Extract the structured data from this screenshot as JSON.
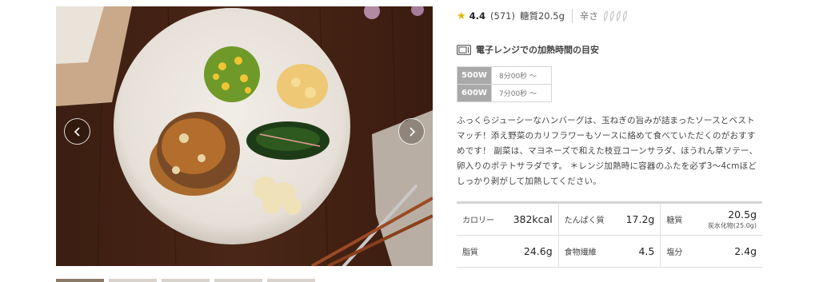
{
  "product": {
    "rating": "4.4",
    "review_count": "(571)",
    "carbs_badge": "糖質20.5g",
    "spicy_label": "辛さ",
    "spicy_level": 0
  },
  "microwave": {
    "title": "電子レンジでの加熱時間の目安",
    "rows": [
      {
        "watt": "500W",
        "time": "8分00秒 〜"
      },
      {
        "watt": "600W",
        "time": "7分00秒 〜"
      }
    ]
  },
  "description": "ふっくらジューシーなハンバーグは、玉ねぎの旨みが詰まったソースとベストマッチ！添え野菜のカリフラワーもソースに絡めて食べていただくのがおすすめです！ 副菜は、マヨネーズで和えた枝豆コーンサラダ、ほうれん草ソテー、卵入りのポテトサラダです。 ＊レンジ加熱時に容器のふたを必ず3〜4cmほどしっかり剥がして加熱してください。",
  "nutrition": {
    "row1": [
      {
        "label": "カロリー",
        "value": "382kcal"
      },
      {
        "label": "たんぱく質",
        "value": "17.2g"
      },
      {
        "label": "糖質",
        "value": "20.5g",
        "sub": "炭水化物(25.0g)"
      }
    ],
    "row2": [
      {
        "label": "脂質",
        "value": "24.6g"
      },
      {
        "label": "食物繊維",
        "value": "4.5"
      },
      {
        "label": "塩分",
        "value": "2.4g"
      }
    ]
  },
  "gallery": {
    "prev_icon": "chevron-left-icon",
    "next_icon": "chevron-right-icon",
    "active_index": 0,
    "thumb_count": 5
  },
  "colors": {
    "star": "#e8b400",
    "watt_bg": "#a9a9a9",
    "table_border": "#d4d4d4"
  }
}
